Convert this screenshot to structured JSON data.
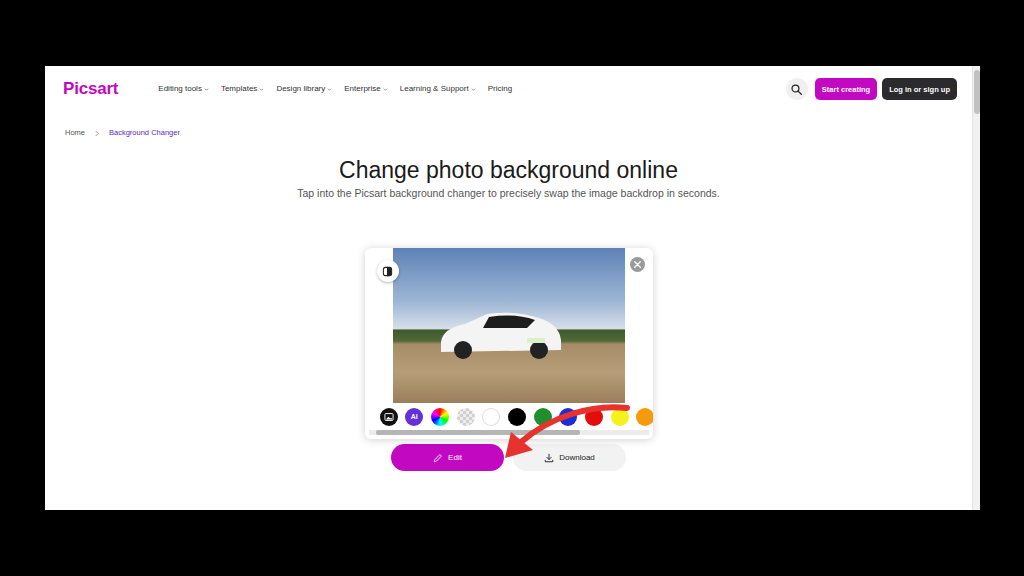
{
  "brand": {
    "logo": "Picsart"
  },
  "nav": {
    "items": [
      {
        "label": "Editing tools",
        "has_menu": true
      },
      {
        "label": "Templates",
        "has_menu": true
      },
      {
        "label": "Design library",
        "has_menu": true
      },
      {
        "label": "Enterprise",
        "has_menu": true
      },
      {
        "label": "Learning & Support",
        "has_menu": true
      },
      {
        "label": "Pricing",
        "has_menu": false
      }
    ],
    "actions": [
      {
        "label": "Start creating",
        "kind": "primary"
      },
      {
        "label": "Log in or sign up",
        "kind": "dark"
      }
    ]
  },
  "breadcrumb": [
    {
      "label": "Home",
      "selected": false
    },
    {
      "label": "Background Changer",
      "selected": true
    }
  ],
  "hero": {
    "title": "Change photo background online",
    "subtitle": "Tap into the Picsart background changer to precisely swap the image backdrop in seconds."
  },
  "editor": {
    "swatches": [
      {
        "kind": "image"
      },
      {
        "kind": "ai",
        "label": "Ai"
      },
      {
        "kind": "gradient"
      },
      {
        "kind": "transparent"
      },
      {
        "kind": "solid",
        "color": "#ffffff"
      },
      {
        "kind": "solid",
        "color": "#000000"
      },
      {
        "kind": "solid",
        "color": "#1f8f2e"
      },
      {
        "kind": "solid",
        "color": "#1a2fd6"
      },
      {
        "kind": "solid",
        "color": "#e30d0d"
      },
      {
        "kind": "solid",
        "color": "#f5f11a"
      },
      {
        "kind": "solid",
        "color": "#f59a0a"
      }
    ],
    "swatch_scroll": {
      "level": 0.77
    },
    "buttons": [
      {
        "label": "Edit",
        "kind": "primary"
      },
      {
        "label": "Download",
        "kind": "secondary"
      }
    ]
  },
  "page_scroll": {
    "level": 0.1
  }
}
